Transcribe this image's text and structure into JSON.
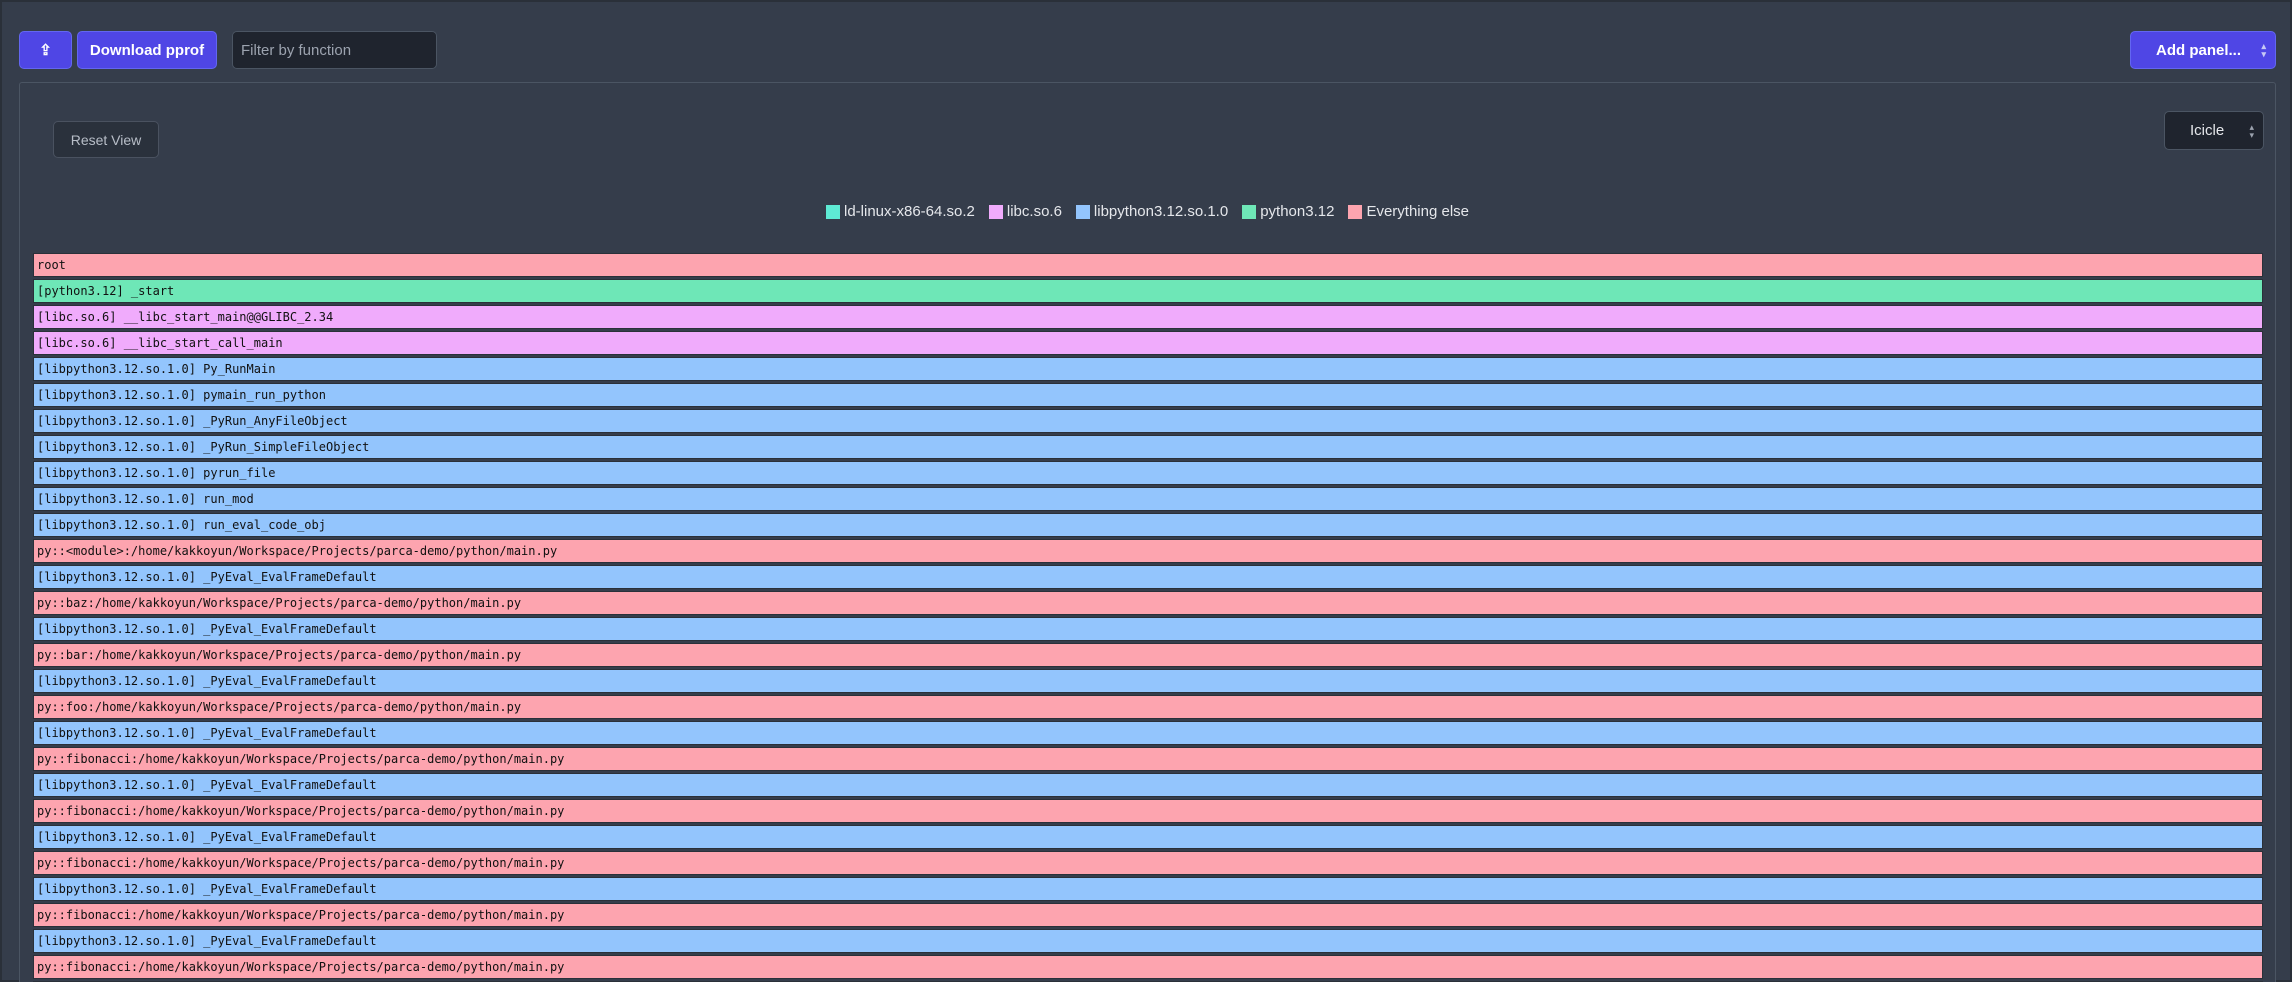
{
  "toolbar": {
    "share_icon": "share-icon",
    "share_glyph": "⇪",
    "download_label": "Download pprof",
    "filter_placeholder": "Filter by function",
    "filter_value": "",
    "filter_go_glyph": "›",
    "add_panel_label": "Add panel...",
    "updown_up": "▴",
    "updown_down": "▾"
  },
  "panel": {
    "reset_label": "Reset View",
    "view_selected": "Icicle"
  },
  "legend": [
    {
      "label": "ld-linux-x86-64.so.2",
      "color": "#5eead4"
    },
    {
      "label": "libc.so.6",
      "color": "#f0abfc"
    },
    {
      "label": "libpython3.12.so.1.0",
      "color": "#93c5fd"
    },
    {
      "label": "python3.12",
      "color": "#6ee7b7"
    },
    {
      "label": "Everything else",
      "color": "#fda4af"
    }
  ],
  "colors": {
    "root": "#fda4af",
    "python": "#6ee7b7",
    "libc": "#f0abfc",
    "libpython": "#93c5fd",
    "else": "#fda4af",
    "accent": "#4f46e5"
  },
  "frames": [
    {
      "label": "root",
      "group": "root"
    },
    {
      "label": "[python3.12] _start",
      "group": "python"
    },
    {
      "label": "[libc.so.6] __libc_start_main@@GLIBC_2.34",
      "group": "libc"
    },
    {
      "label": "[libc.so.6] __libc_start_call_main",
      "group": "libc"
    },
    {
      "label": "[libpython3.12.so.1.0] Py_RunMain",
      "group": "libpython"
    },
    {
      "label": "[libpython3.12.so.1.0] pymain_run_python",
      "group": "libpython"
    },
    {
      "label": "[libpython3.12.so.1.0] _PyRun_AnyFileObject",
      "group": "libpython"
    },
    {
      "label": "[libpython3.12.so.1.0] _PyRun_SimpleFileObject",
      "group": "libpython"
    },
    {
      "label": "[libpython3.12.so.1.0] pyrun_file",
      "group": "libpython"
    },
    {
      "label": "[libpython3.12.so.1.0] run_mod",
      "group": "libpython"
    },
    {
      "label": "[libpython3.12.so.1.0] run_eval_code_obj",
      "group": "libpython"
    },
    {
      "label": "py::<module>:/home/kakkoyun/Workspace/Projects/parca-demo/python/main.py",
      "group": "else"
    },
    {
      "label": "[libpython3.12.so.1.0] _PyEval_EvalFrameDefault",
      "group": "libpython"
    },
    {
      "label": "py::baz:/home/kakkoyun/Workspace/Projects/parca-demo/python/main.py",
      "group": "else"
    },
    {
      "label": "[libpython3.12.so.1.0] _PyEval_EvalFrameDefault",
      "group": "libpython"
    },
    {
      "label": "py::bar:/home/kakkoyun/Workspace/Projects/parca-demo/python/main.py",
      "group": "else"
    },
    {
      "label": "[libpython3.12.so.1.0] _PyEval_EvalFrameDefault",
      "group": "libpython"
    },
    {
      "label": "py::foo:/home/kakkoyun/Workspace/Projects/parca-demo/python/main.py",
      "group": "else"
    },
    {
      "label": "[libpython3.12.so.1.0] _PyEval_EvalFrameDefault",
      "group": "libpython"
    },
    {
      "label": "py::fibonacci:/home/kakkoyun/Workspace/Projects/parca-demo/python/main.py",
      "group": "else"
    },
    {
      "label": "[libpython3.12.so.1.0] _PyEval_EvalFrameDefault",
      "group": "libpython"
    },
    {
      "label": "py::fibonacci:/home/kakkoyun/Workspace/Projects/parca-demo/python/main.py",
      "group": "else"
    },
    {
      "label": "[libpython3.12.so.1.0] _PyEval_EvalFrameDefault",
      "group": "libpython"
    },
    {
      "label": "py::fibonacci:/home/kakkoyun/Workspace/Projects/parca-demo/python/main.py",
      "group": "else"
    },
    {
      "label": "[libpython3.12.so.1.0] _PyEval_EvalFrameDefault",
      "group": "libpython"
    },
    {
      "label": "py::fibonacci:/home/kakkoyun/Workspace/Projects/parca-demo/python/main.py",
      "group": "else"
    },
    {
      "label": "[libpython3.12.so.1.0] _PyEval_EvalFrameDefault",
      "group": "libpython"
    },
    {
      "label": "py::fibonacci:/home/kakkoyun/Workspace/Projects/parca-demo/python/main.py",
      "group": "else"
    },
    {
      "label": "[libpython3.12.so.1.0] _PyEval_EvalFrameDefault",
      "group": "libpython"
    }
  ]
}
